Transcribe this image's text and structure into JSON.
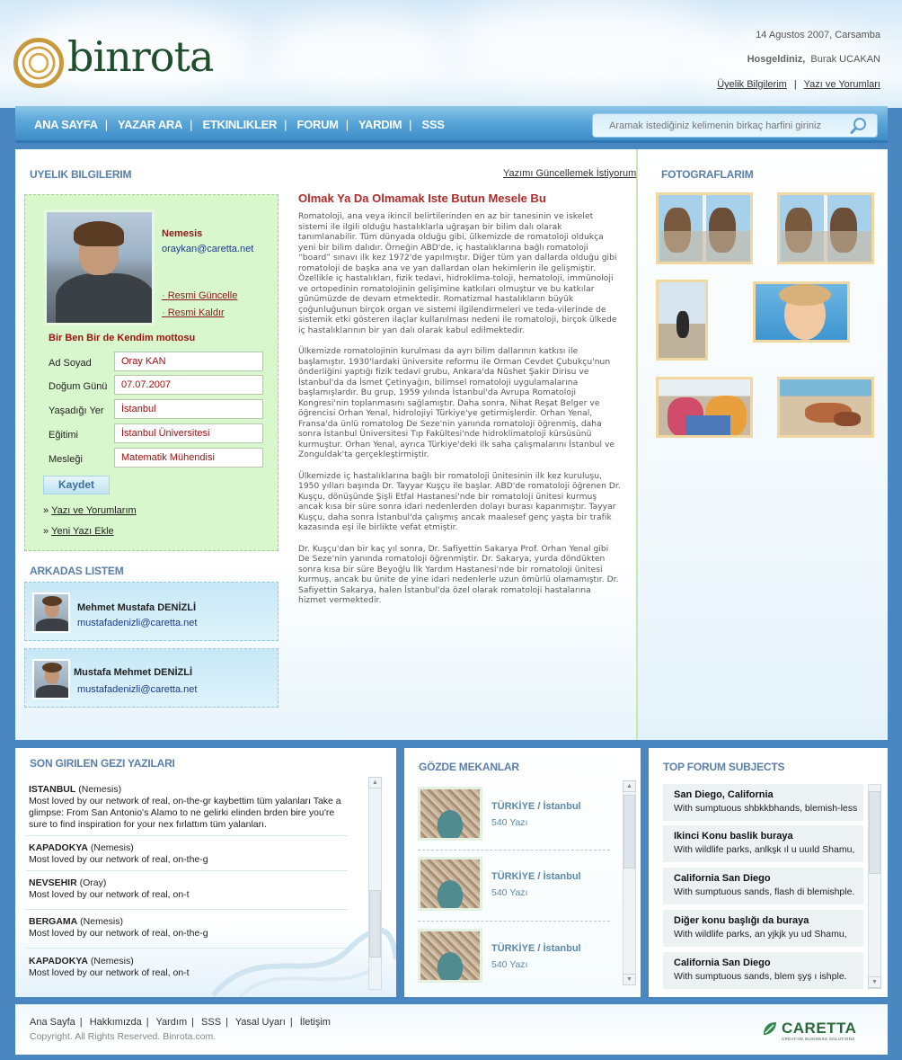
{
  "header": {
    "logo_text": "binrota",
    "date": "14 Agustos 2007, Carsamba",
    "welcome_label": "Hosgeldiniz,",
    "user_name": "Burak UCAKAN",
    "links": [
      "Üyelik Bilgilerim",
      "Yazı ve Yorumları"
    ]
  },
  "nav": {
    "items": [
      "ANA SAYFA",
      "YAZAR ARA",
      "ETKINLIKLER",
      "FORUM",
      "YARDIM",
      "SSS"
    ],
    "search_placeholder": "Aramak istediğiniz kelimenin birkaç harfini giriniz",
    "search_icon": "search-icon"
  },
  "profile": {
    "title": "UYELIK BILGILERIM",
    "update_link": "Yazımı Güncellemek İstiyorum",
    "name": "Nemesis",
    "email": "oraykan@caretta.net",
    "photo_links": [
      "Resmi Güncelle",
      "Resmi Kaldır"
    ],
    "motto": "Bir Ben Bir de Kendim mottosu",
    "fields": [
      {
        "label": "Ad Soyad",
        "value": "Oray KAN"
      },
      {
        "label": "Doğum Günü",
        "value": "07.07.2007"
      },
      {
        "label": "Yaşadığı Yer",
        "value": "İstanbul"
      },
      {
        "label": "Eğitimi",
        "value": "İstanbul Üniversitesi"
      },
      {
        "label": "Mesleği",
        "value": "Matematik Mühendisi"
      }
    ],
    "save_label": "Kaydet",
    "bottom_links": [
      "Yazı ve Yorumlarım",
      "Yeni Yazı Ekle"
    ]
  },
  "friends": {
    "title": "ARKADAS LISTEM",
    "items": [
      {
        "name": "Mehmet Mustafa DENİZLİ",
        "email": "mustafadenizli@caretta.net"
      },
      {
        "name": "Mustafa Mehmet  DENİZLİ",
        "email": "mustafadenizli@caretta.net"
      }
    ]
  },
  "article": {
    "title": "Olmak Ya Da Olmamak Iste Butun Mesele Bu",
    "paragraphs": [
      "Romatoloji, ana veya ikincil belirtilerinden en az bir tanesinin ve iskelet sistemi ile ilgili olduğu hastalıklarla uğraşan bir bilim dalı olarak tanımlanabilir. Tüm dünyada olduğu gibi, ülkemizde de romatoloji oldukça yeni bir bilim dalıdır. Örneğin ABD'de, iç hastalıklarına bağlı romatoloji “board” sınavı ilk kez 1972'de yapılmıştır. Diğer tüm yan dallarda olduğu gibi romatoloji de başka ana ve yan dallardan olan hekimlerin ile gelişmiştir. Özellikle iç hastalıkları, fizik tedavi, hidroklima-toloji, hematoloji, immünoloji ve ortopedinin romatolojinin gelişimine katkıları olmuştur ve bu katkılar günümüzde de devam etmektedir. Romatizmal hastalıkların büyük çoğunluğunun birçok organ ve sistemi ilgilendirmeleri ve teda-vilerinde de sistemik etki gösteren ilaçlar kullanılması nedeni ile romatoloji, birçok ülkede iç hastalıklarının bir yan dalı olarak kabul edilmektedir.",
      "Ülkemizde romatolojinin kurulması da ayrı bilim dallarının katkısı ile başlamıştır. 1930'lardaki üniversite reformu ile Orman Cevdet Çubukçu'nun önderliğini yaptığı fizik tedavi grubu, Ankara'da Nüshet Şakir Dirisu ve İstanbul'da da İsmet Çetinyağın, bilimsel romatoloji uygulamalarına başlamışlardır. Bu grup, 1959 yılında İstanbul'da Avrupa Romatoloji Kongresi'nin toplanmasını sağlamıştır. Daha sonra, Nihat Reşat Belger ve öğrencisi Orhan Yenal, hidrolojiyi Türkiye'ye getirmişlerdir. Orhan Yenal, Fransa'da ünlü romatolog De Seze'nin yanında romatoloji öğrenmiş, daha sonra İstanbul Üniversitesi Tıp Fakültesi'nde hidroklimatoloji kürsüsünü kurmuştur. Orhan Yenal, ayrıca Türkiye'deki ilk saha çalışmalarını İstanbul ve Zonguldak'ta gerçekleştirmiştir.",
      "Ülkemizde iç hastalıklarına bağlı bir romatoloji ünitesinin ilk kez kuruluşu, 1950 yılları başında Dr. Tayyar Kuşçu ile başlar. ABD'de romatoloji öğrenen Dr. Kuşçu, dönüşünde Şişli Etfal Hastanesi'nde bir romatoloji ünitesi kurmuş ancak kısa bir süre sonra idari nedenlerden dolayı burası kapanmıştır. Tayyar Kuşçu, daha sonra İstanbul'da çalışmış ancak maalesef genç yaşta bir trafik kazasında eşi ile birlikte vefat etmiştir.",
      "Dr. Kuşçu'dan bir kaç yıl sonra, Dr. Safiyettin Sakarya Prof. Orhan Yenal gibi De Seze'nin yanında romatoloji öğrenmiştir. Dr. Sakarya, yurda döndükten sonra kısa bir süre Beyoğlu İlk Yardım Hastanesi'nde bir romatoloji ünitesi kurmuş, ancak bu ünite de yine idari nedenlerle uzun ömürlü olamamıştır. Dr. Safiyettin Sakarya, halen İstanbul'da özel olarak romatoloji hastalarına hizmet vermektedir."
    ]
  },
  "photos": {
    "title": "FOTOGRAFLARIM"
  },
  "gezi": {
    "title": "SON GIRILEN GEZI YAZILARI",
    "items": [
      {
        "place": "ISTANBUL",
        "author": "(Nemesis)",
        "text": "Most loved by our network of real, on-the-gr kaybettim tüm yalanları Take a glimpse: From San Antonio's Alamo to ne gelirki elinden brden bire you're sure to find inspiration for your nex fırlattım tüm yalanları."
      },
      {
        "place": "KAPADOKYA",
        "author": "(Nemesis)",
        "text": "Most loved by our network of real, on-the-g"
      },
      {
        "place": "NEVSEHIR",
        "author": "(Oray)",
        "text": "Most loved by our network of real, on-t"
      },
      {
        "place": "BERGAMA",
        "author": "(Nemesis)",
        "text": "Most loved by our network of real, on-the-g"
      },
      {
        "place": "KAPADOKYA",
        "author": "(Nemesis)",
        "text": "Most loved by our network of real, on-t"
      }
    ]
  },
  "mekanlar": {
    "title": "GÖZDE MEKANLAR",
    "items": [
      {
        "location": "TÜRKİYE / İstanbul",
        "count": "540 Yazı"
      },
      {
        "location": "TÜRKİYE / İstanbul",
        "count": "540 Yazı"
      },
      {
        "location": "TÜRKİYE / İstanbul",
        "count": "540 Yazı"
      }
    ]
  },
  "forum": {
    "title": "TOP FORUM SUBJECTS",
    "items": [
      {
        "title": "San Diego, California",
        "text": "With sumptuous shbkkbhands, blemish-less"
      },
      {
        "title": "Ikinci Konu baslik buraya",
        "text": "With wildlife parks, anlkşk ıl u  uuıld Shamu,"
      },
      {
        "title": "California San Diego",
        "text": "With sumptuous sands, flash di blemishple."
      },
      {
        "title": "Diğer konu başlığı da buraya",
        "text": "With wildlife parks, an yjkjk yu  ud Shamu,"
      },
      {
        "title": "California San Diego",
        "text": "With sumptuous sands, blem şyş ı ishple."
      }
    ]
  },
  "footer": {
    "links": [
      "Ana Sayfa",
      "Hakkımızda",
      "Yardım",
      "SSS",
      "Yasal Uyarı",
      "İletişim"
    ],
    "copyright": "Copyright. All Rights Reserved. Binrota.com.",
    "brand": "CARETTA",
    "brand_sub": "CREATIVE BUSINESS SOLUTIONS"
  }
}
